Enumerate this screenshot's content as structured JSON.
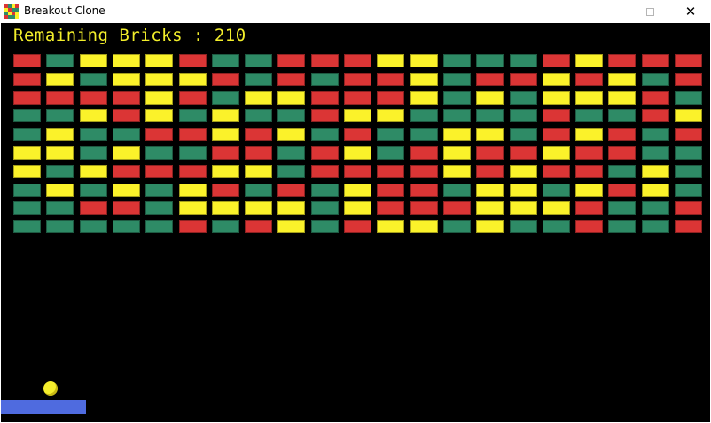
{
  "window": {
    "title": "Breakout Clone",
    "icon": "breakout-app-icon",
    "controls": {
      "minimize": "minimize-icon",
      "maximize": "maximize-icon",
      "close": "close-icon",
      "close_glyph": "✕"
    }
  },
  "hud": {
    "remaining_label": "Remaining Bricks : ",
    "remaining_count": "210"
  },
  "colors": {
    "R": "#db3535",
    "G": "#2e8b66",
    "Y": "#fbf22a",
    "text": "#f2ee2b",
    "background": "#000000",
    "ball": "#f5ee2c",
    "paddle": "#4f6bdf"
  },
  "bricks": [
    "RGYYYRGGRRRYYGGGRYRRR",
    "RYGYYYRGRGRRYGRRYRYGR",
    "RRRRYRGYYRRRYGYGYYYRG",
    "GGYRYGYGGRYYGGGGRGGRY",
    "GYGGRRYRYGRGGYYGRYRGR",
    "YYGYGGRRGRYGRYRRYRRGG",
    "YGYRRRYYGRRRRYRYRRGYG",
    "GYGYGYRGRGYRRGYYGYRYG",
    "GGRRGYYYYGYRRRYYYRGGR",
    "GGGGGRGRYGRYYGYGGRGGR"
  ]
}
